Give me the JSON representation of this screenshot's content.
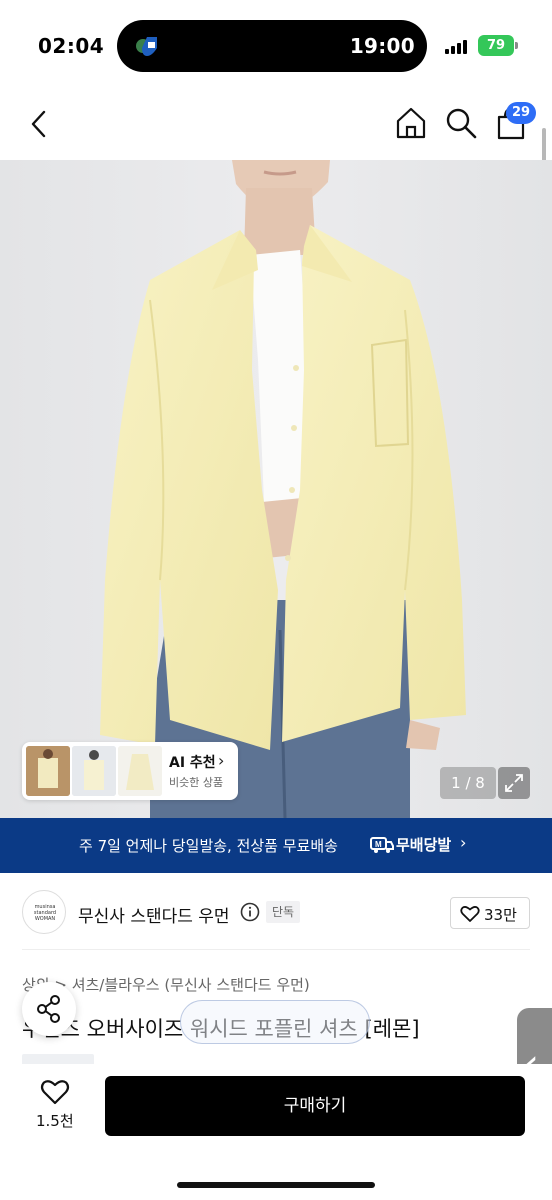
{
  "status_bar": {
    "time": "02:04",
    "island_time": "19:00",
    "battery": "79"
  },
  "nav": {
    "cart_count": "29"
  },
  "gallery": {
    "ai_title": "AI 추천",
    "ai_subtitle": "비슷한 상품",
    "pager": "1 / 8"
  },
  "shipping": {
    "text": "주 7일 언제나 당일발송, 전상품 무료배송",
    "logo_text": "무배당발"
  },
  "brand": {
    "name": "무신사 스탠다드 우먼",
    "logo_text": "musinsa standard WOMAN",
    "exclusive": "단독",
    "likes": "33만"
  },
  "product": {
    "category": "상의 > 셔츠/블라우스 (무신사 스탠다드 우먼)",
    "title": "우먼즈 오버사이즈 워시드 포플린 셔츠 [레몬]"
  },
  "bottom": {
    "wish_count": "1.5천",
    "buy_label": "구매하기"
  },
  "colors": {
    "banner": "#0b3a86",
    "badge": "#2e6df6",
    "shirt": "#f6efb8"
  }
}
